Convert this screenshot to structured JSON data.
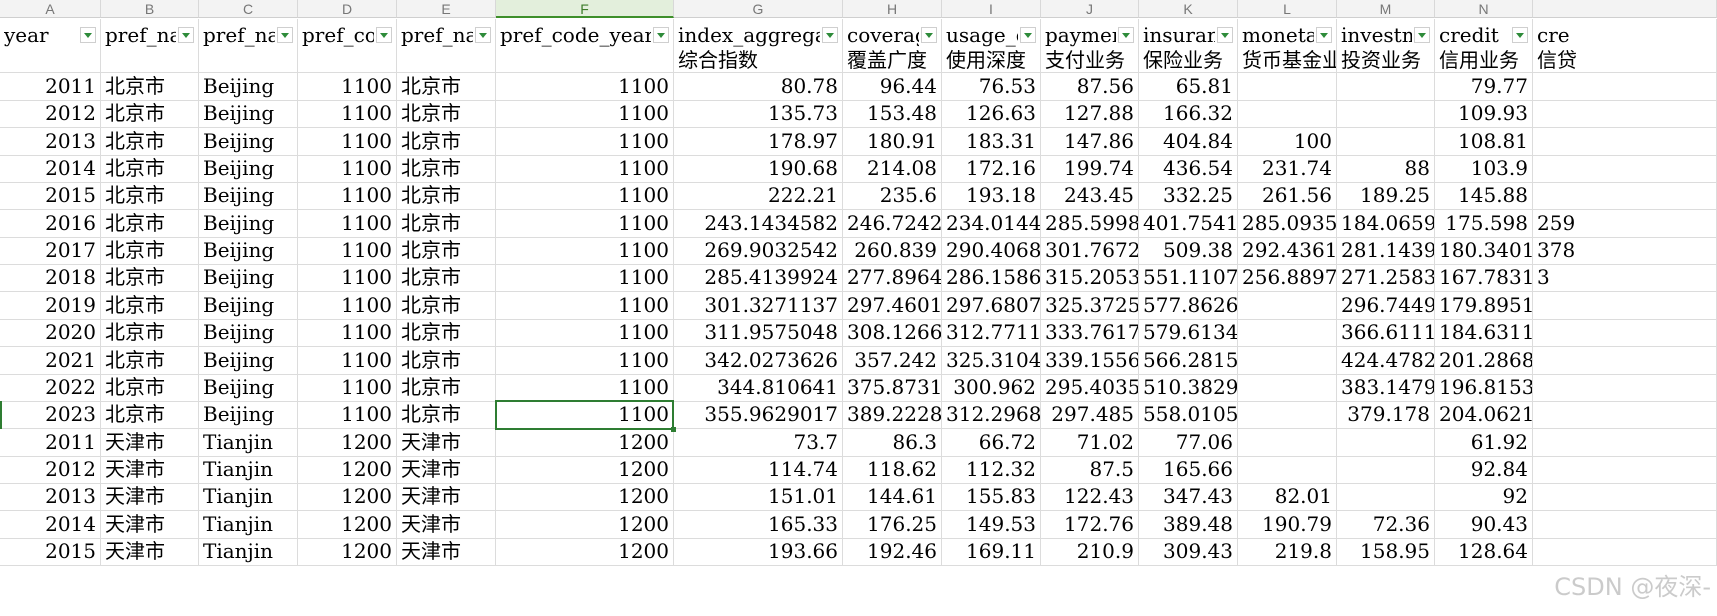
{
  "sheet": {
    "column_letters": [
      "A",
      "B",
      "C",
      "D",
      "E",
      "F",
      "G",
      "H",
      "I",
      "J",
      "K",
      "L",
      "M",
      "N",
      ""
    ],
    "selected_column": "F",
    "selected_cell": "F13",
    "header_row": [
      {
        "top": "year",
        "sub": ""
      },
      {
        "top": "pref_na",
        "sub": ""
      },
      {
        "top": "pref_na",
        "sub": ""
      },
      {
        "top": "pref_co",
        "sub": ""
      },
      {
        "top": "pref_na",
        "sub": ""
      },
      {
        "top": "pref_code_year",
        "sub": ""
      },
      {
        "top": "index_aggrega",
        "sub": "综合指数"
      },
      {
        "top": "coverag",
        "sub": "覆盖广度"
      },
      {
        "top": "usage_d",
        "sub": "使用深度"
      },
      {
        "top": "payment",
        "sub": "支付业务"
      },
      {
        "top": "insuran",
        "sub": "保险业务"
      },
      {
        "top": "monetar",
        "sub": "货币基金业"
      },
      {
        "top": "investm",
        "sub": "投资业务"
      },
      {
        "top": "credit",
        "sub": "信用业务"
      },
      {
        "top": "cre",
        "sub": "信贷"
      }
    ],
    "rows": [
      [
        "2011",
        "北京市",
        "Beijing",
        "1100",
        "北京市",
        "1100",
        "80.78",
        "96.44",
        "76.53",
        "87.56",
        "65.81",
        "",
        "",
        "79.77",
        ""
      ],
      [
        "2012",
        "北京市",
        "Beijing",
        "1100",
        "北京市",
        "1100",
        "135.73",
        "153.48",
        "126.63",
        "127.88",
        "166.32",
        "",
        "",
        "109.93",
        ""
      ],
      [
        "2013",
        "北京市",
        "Beijing",
        "1100",
        "北京市",
        "1100",
        "178.97",
        "180.91",
        "183.31",
        "147.86",
        "404.84",
        "100",
        "",
        "108.81",
        ""
      ],
      [
        "2014",
        "北京市",
        "Beijing",
        "1100",
        "北京市",
        "1100",
        "190.68",
        "214.08",
        "172.16",
        "199.74",
        "436.54",
        "231.74",
        "88",
        "103.9",
        ""
      ],
      [
        "2015",
        "北京市",
        "Beijing",
        "1100",
        "北京市",
        "1100",
        "222.21",
        "235.6",
        "193.18",
        "243.45",
        "332.25",
        "261.56",
        "189.25",
        "145.88",
        ""
      ],
      [
        "2016",
        "北京市",
        "Beijing",
        "1100",
        "北京市",
        "1100",
        "243.1434582",
        "246.7242",
        "234.0144",
        "285.5998",
        "401.7541",
        "285.0935",
        "184.0659",
        "175.598",
        "259"
      ],
      [
        "2017",
        "北京市",
        "Beijing",
        "1100",
        "北京市",
        "1100",
        "269.9032542",
        "260.839",
        "290.4068",
        "301.7672",
        "509.38",
        "292.4361",
        "281.1439",
        "180.3401",
        "378"
      ],
      [
        "2018",
        "北京市",
        "Beijing",
        "1100",
        "北京市",
        "1100",
        "285.4139924",
        "277.8964",
        "286.1586",
        "315.2053",
        "551.1107",
        "256.8897",
        "271.2583",
        "167.7831",
        "3"
      ],
      [
        "2019",
        "北京市",
        "Beijing",
        "1100",
        "北京市",
        "1100",
        "301.3271137",
        "297.4601",
        "297.6807",
        "325.3725",
        "577.8626",
        "",
        "296.7449",
        "179.8951",
        ""
      ],
      [
        "2020",
        "北京市",
        "Beijing",
        "1100",
        "北京市",
        "1100",
        "311.9575048",
        "308.1266",
        "312.7711",
        "333.7617",
        "579.6134",
        "",
        "366.6111",
        "184.6311",
        ""
      ],
      [
        "2021",
        "北京市",
        "Beijing",
        "1100",
        "北京市",
        "1100",
        "342.0273626",
        "357.242",
        "325.3104",
        "339.1556",
        "566.2815",
        "",
        "424.4782",
        "201.2868",
        ""
      ],
      [
        "2022",
        "北京市",
        "Beijing",
        "1100",
        "北京市",
        "1100",
        "344.810641",
        "375.8731",
        "300.962",
        "295.4035",
        "510.3829",
        "",
        "383.1479",
        "196.8153",
        ""
      ],
      [
        "2023",
        "北京市",
        "Beijing",
        "1100",
        "北京市",
        "1100",
        "355.9629017",
        "389.2228",
        "312.2968",
        "297.485",
        "558.0105",
        "",
        "379.178",
        "204.0621",
        ""
      ],
      [
        "2011",
        "天津市",
        "Tianjin",
        "1200",
        "天津市",
        "1200",
        "73.7",
        "86.3",
        "66.72",
        "71.02",
        "77.06",
        "",
        "",
        "61.92",
        ""
      ],
      [
        "2012",
        "天津市",
        "Tianjin",
        "1200",
        "天津市",
        "1200",
        "114.74",
        "118.62",
        "112.32",
        "87.5",
        "165.66",
        "",
        "",
        "92.84",
        ""
      ],
      [
        "2013",
        "天津市",
        "Tianjin",
        "1200",
        "天津市",
        "1200",
        "151.01",
        "144.61",
        "155.83",
        "122.43",
        "347.43",
        "82.01",
        "",
        "92",
        ""
      ],
      [
        "2014",
        "天津市",
        "Tianjin",
        "1200",
        "天津市",
        "1200",
        "165.33",
        "176.25",
        "149.53",
        "172.76",
        "389.48",
        "190.79",
        "72.36",
        "90.43",
        ""
      ],
      [
        "2015",
        "天津市",
        "Tianjin",
        "1200",
        "天津市",
        "1200",
        "193.66",
        "192.46",
        "169.11",
        "210.9",
        "309.43",
        "219.8",
        "158.95",
        "128.64",
        ""
      ]
    ],
    "numeric_columns": [
      0,
      3,
      5,
      6,
      7,
      8,
      9,
      10,
      11,
      12,
      13
    ],
    "watermark": "CSDN @夜深-"
  }
}
